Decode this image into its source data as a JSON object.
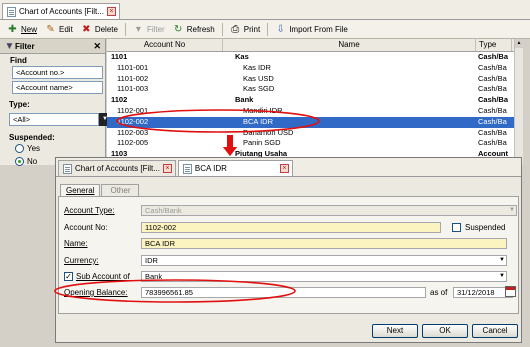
{
  "main_window": {
    "tab_title": "Chart of Accounts [Filt...",
    "toolbar": {
      "new": "New",
      "edit": "Edit",
      "delete": "Delete",
      "filter": "Filter",
      "refresh": "Refresh",
      "print": "Print",
      "import": "Import From File"
    },
    "filter_panel": {
      "title": "Filter",
      "find_label": "Find",
      "account_no_field": "<Account no.>",
      "account_name_field": "<Account name>",
      "type_label": "Type:",
      "type_value": "<All>",
      "suspended_label": "Suspended:",
      "opt_yes": "Yes",
      "opt_no": "No"
    },
    "grid": {
      "columns": [
        "Account No",
        "Name",
        "Type"
      ],
      "rows": [
        {
          "no": "1101",
          "name": "Kas",
          "type": "Cash/Ba",
          "bold": true,
          "sel": false
        },
        {
          "no": "1101-001",
          "name": "Kas IDR",
          "type": "Cash/Ba",
          "bold": false,
          "sel": false
        },
        {
          "no": "1101-002",
          "name": "Kas USD",
          "type": "Cash/Ba",
          "bold": false,
          "sel": false
        },
        {
          "no": "1101-003",
          "name": "Kas SGD",
          "type": "Cash/Ba",
          "bold": false,
          "sel": false
        },
        {
          "no": "1102",
          "name": "Bank",
          "type": "Cash/Ba",
          "bold": true,
          "sel": false
        },
        {
          "no": "1102-001",
          "name": "Mandiri IDR",
          "type": "Cash/Ba",
          "bold": false,
          "sel": false
        },
        {
          "no": "1102-002",
          "name": "BCA IDR",
          "type": "Cash/Ba",
          "bold": false,
          "sel": true
        },
        {
          "no": "1102-003",
          "name": "Danamon USD",
          "type": "Cash/Ba",
          "bold": false,
          "sel": false
        },
        {
          "no": "1102-005",
          "name": "Panin SGD",
          "type": "Cash/Ba",
          "bold": false,
          "sel": false
        },
        {
          "no": "1103",
          "name": "Piutang Usaha",
          "type": "Account",
          "bold": true,
          "sel": false
        }
      ]
    }
  },
  "detail_window": {
    "tab1": "Chart of Accounts [Filt...",
    "tab2": "BCA IDR",
    "subtabs": [
      "General",
      "Other"
    ],
    "labels": {
      "account_type": "Account Type:",
      "account_no": "Account No:",
      "name": "Name:",
      "currency": "Currency:",
      "sub_account": "Sub Account of",
      "opening_balance": "Opening Balance:",
      "as_of": "as of",
      "suspended": "Suspended"
    },
    "values": {
      "account_type": "Cash/Bank",
      "account_no": "1102-002",
      "name": "BCA IDR",
      "currency": "IDR",
      "sub_account": "Bank",
      "opening_balance": "783996561.85",
      "as_of_date": "31/12/2018"
    },
    "buttons": {
      "next": "Next",
      "ok": "OK",
      "cancel": "Cancel"
    }
  },
  "colors": {
    "selection": "#3169c6",
    "highlight_ring": "#e01010",
    "required_field": "#fbf3c0"
  }
}
